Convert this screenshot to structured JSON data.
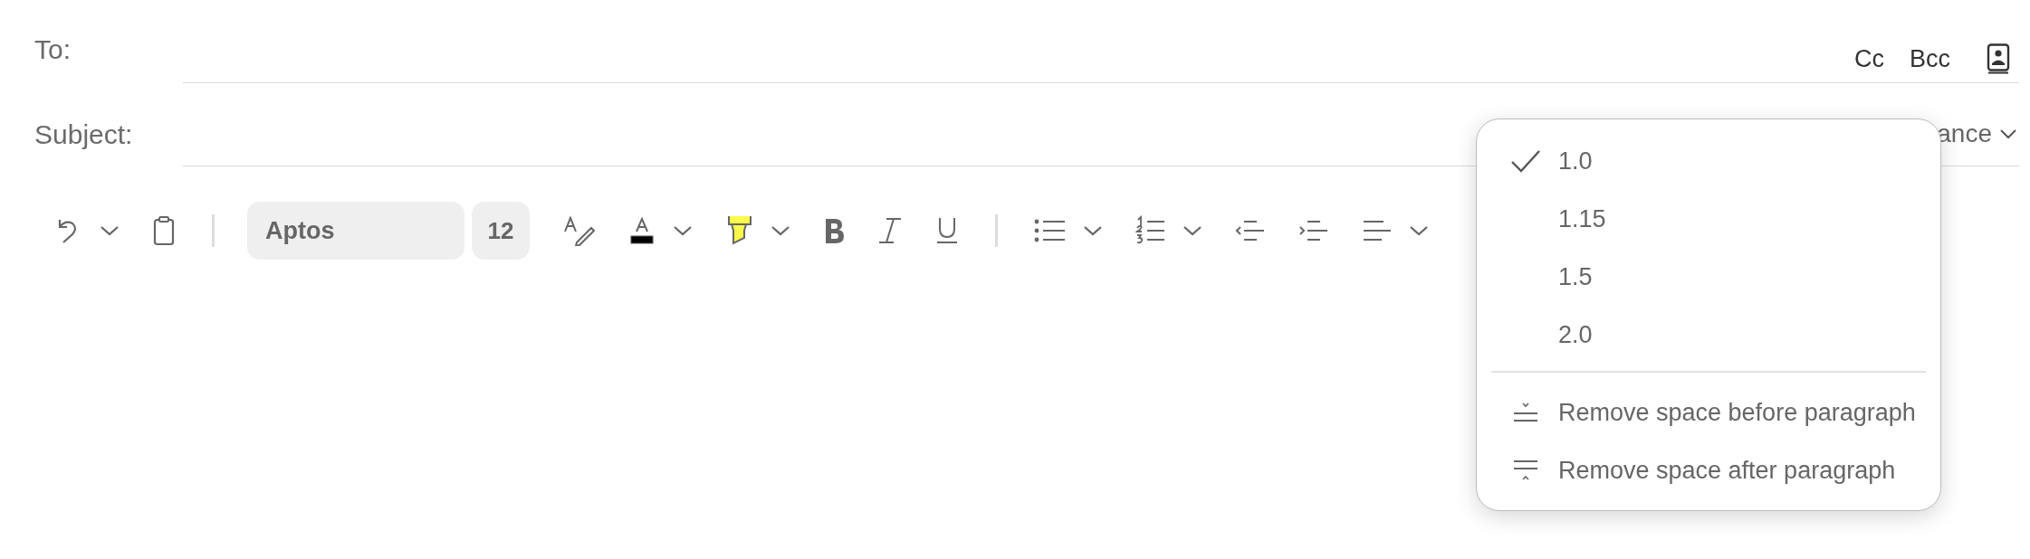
{
  "to": {
    "label": "To:"
  },
  "recipient_actions": [
    "Cc",
    "Bcc"
  ],
  "subject": {
    "label": "Subject:",
    "trailing_text": "ance"
  },
  "toolbar": {
    "font": "Aptos",
    "size": "12"
  },
  "spacing_menu": {
    "options": [
      {
        "label": "1.0",
        "selected": true
      },
      {
        "label": "1.15",
        "selected": false
      },
      {
        "label": "1.5",
        "selected": false
      },
      {
        "label": "2.0",
        "selected": false
      }
    ],
    "actions": [
      {
        "label": "Remove space before paragraph",
        "kind": "before"
      },
      {
        "label": "Remove space after paragraph",
        "kind": "after"
      }
    ]
  }
}
